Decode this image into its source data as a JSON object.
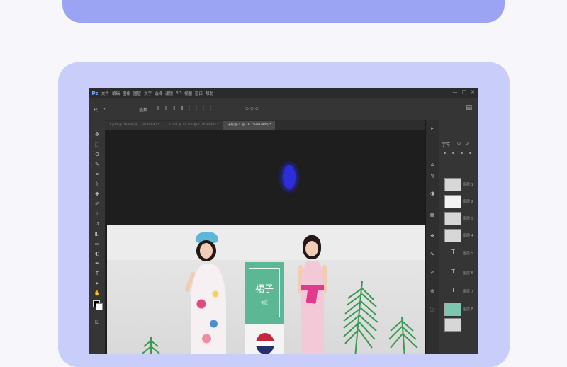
{
  "menubar": {
    "logo": "Ps",
    "items": [
      "文件",
      "编辑",
      "图像",
      "图层",
      "文字",
      "选择",
      "滤镜",
      "3D",
      "视图",
      "窗口",
      "帮助"
    ],
    "window_controls": [
      "—",
      "□",
      "✕"
    ]
  },
  "options": {
    "tool_label": "尺",
    "mode": "选择",
    "glyphs": "⫴ ⫴ ⫴ ⫴ ⫶ ⫶ ⫶ ⫶ ⫶ ⫶",
    "extra": "⊙ ⊙ ⊙"
  },
  "tabs": [
    {
      "label": "1.psd @ 18.8%(组 1, RGB/8#) *",
      "active": false
    },
    {
      "label": "2.psd @ 18.8%(组 1, RGB/8#) *",
      "active": false
    },
    {
      "label": "未标题-1 @ 16.7%(RGB/8) *",
      "active": true
    }
  ],
  "banner": {
    "title": "裙子",
    "subtitle": "— 专区 —"
  },
  "panel": {
    "character_label": "字符",
    "layers": [
      "图层 1",
      "图层 2",
      "图层 3",
      "图层 4",
      "图层 5",
      "图层 6",
      "图层 7",
      "图层 8"
    ]
  },
  "colors": {
    "page_bg": "#f6f6fb",
    "card_top": "#9aa4f2",
    "card_main": "#c9cdfa",
    "ps_dark": "#1e1e1f",
    "green_box": "#5cb894",
    "cursor": "#2b2ed9"
  }
}
